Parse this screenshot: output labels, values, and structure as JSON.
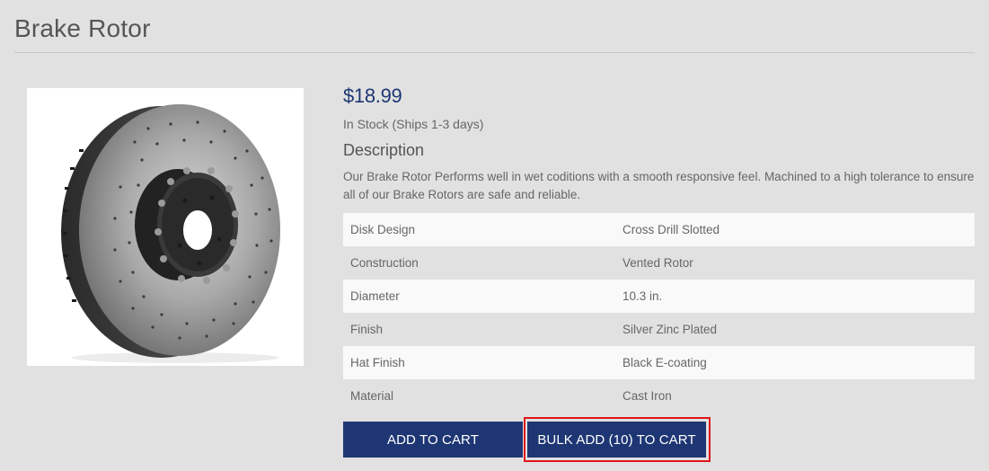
{
  "product": {
    "title": "Brake Rotor",
    "price": "$18.99",
    "stock_status": "In Stock (Ships 1-3 days)",
    "description_heading": "Description",
    "description_text": "Our Brake Rotor Performs well in wet coditions with a smooth responsive feel. Machined to a high tolerance to ensure all of our Brake Rotors are safe and reliable.",
    "image_icon": "brake-rotor-image"
  },
  "specs": [
    {
      "label": "Disk Design",
      "value": "Cross Drill Slotted"
    },
    {
      "label": "Construction",
      "value": "Vented Rotor"
    },
    {
      "label": "Diameter",
      "value": "10.3 in."
    },
    {
      "label": "Finish",
      "value": "Silver Zinc Plated"
    },
    {
      "label": "Hat Finish",
      "value": "Black E-coating"
    },
    {
      "label": "Material",
      "value": "Cast Iron"
    }
  ],
  "actions": {
    "add_to_cart_label": "ADD TO CART",
    "bulk_add_label": "BULK ADD (10) TO CART"
  },
  "colors": {
    "accent": "#1e3674",
    "highlight": "#e0151b",
    "background": "#e1e1e1"
  }
}
